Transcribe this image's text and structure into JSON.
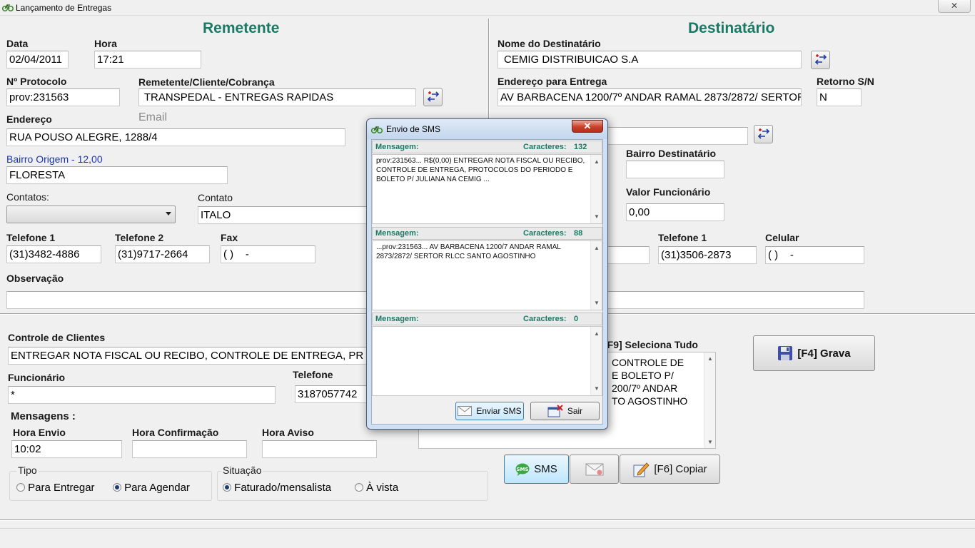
{
  "window": {
    "title": "Lançamento de Entregas",
    "close": "✕"
  },
  "remetente": {
    "heading": "Remetente",
    "data_label": "Data",
    "data_value": "02/04/2011",
    "hora_label": "Hora",
    "hora_value": "17:21",
    "protocolo_label": "Nº Protocolo",
    "protocolo_value": "prov:231563",
    "cliente_label": "Remetente/Cliente/Cobrança",
    "cliente_value": " TRANSPEDAL - ENTREGAS RAPIDAS",
    "email_label": "Email",
    "endereco_label": "Endereço",
    "endereco_value": "RUA POUSO ALEGRE, 1288/4",
    "bairro_label": "Bairro Origem - 12,00",
    "bairro_value": "FLORESTA",
    "contatos_label": "Contatos:",
    "contato_label": "Contato",
    "contato_value": "ITALO",
    "telefone1_label": "Telefone 1",
    "telefone1_value": "(31)3482-4886",
    "telefone2_label": "Telefone 2",
    "telefone2_value": "(31)9717-2664",
    "fax_label": "Fax",
    "fax_value": "( )    -",
    "obs_label": "Observação",
    "obs_value": ""
  },
  "destinatario": {
    "heading": "Destinatário",
    "nome_label": "Nome do Destinatário",
    "nome_value": "CEMIG DISTRIBUICAO S.A",
    "endereco_label": "Endereço para Entrega",
    "endereco_value": "AV BARBACENA 1200/7º ANDAR RAMAL 2873/2872/ SERTOR R",
    "retorno_label": "Retorno S/N",
    "retorno_value": "N",
    "bairro_label": "Bairro Destinatário",
    "bairro_value": "",
    "valor_label": "Valor Funcionário",
    "valor_value": "0,00",
    "telefone1_label": "Telefone 1",
    "telefone1_value": "(31)3506-2873",
    "celular_label": "Celular",
    "celular_value": "( )    -",
    "obs_value": ""
  },
  "bottom": {
    "controle_label": "Controle de Clientes",
    "controle_value": "ENTREGAR NOTA FISCAL OU RECIBO, CONTROLE DE ENTREGA, PR",
    "funcionario_label": "Funcionário",
    "funcionario_value": "*",
    "telefone_label": "Telefone",
    "telefone_value": "3187057742",
    "mensagens_label": "Mensagens :",
    "hora_envio_label": "Hora Envio",
    "hora_envio_value": "10:02",
    "hora_conf_label": "Hora Confirmação",
    "hora_conf_value": "",
    "hora_aviso_label": "Hora Aviso",
    "hora_aviso_value": "",
    "tipo_label": "Tipo",
    "tipo_opt1": "Para Entregar",
    "tipo_opt2": "Para Agendar",
    "situacao_label": "Situação",
    "sit_opt1": "Faturado/mensalista",
    "sit_opt2": "À vista",
    "seleciona_label": "[F9] Seleciona Tudo",
    "obs_lines": [
      "CONTROLE DE",
      "E BOLETO P/",
      "200/7º ANDAR",
      "TO AGOSTINHO"
    ],
    "grava_label": "[F4] Grava",
    "sms_label": "SMS",
    "copiar_label": "[F6] Copiar"
  },
  "dialog": {
    "title": "Envio de SMS",
    "msg_label": "Mensagem:",
    "chars_label": "Caracteres:",
    "messages": [
      {
        "chars": "132",
        "text": "prov:231563... R$(0,00) ENTREGAR NOTA FISCAL OU RECIBO, CONTROLE DE ENTREGA, PROTOCOLOS DO PERIODO E BOLETO P/ JULIANA  NA CEMIG ..."
      },
      {
        "chars": "88",
        "text": "...prov:231563... AV BARBACENA 1200/7 ANDAR RAMAL 2873/2872/ SERTOR RLCC SANTO AGOSTINHO"
      },
      {
        "chars": "0",
        "text": ""
      }
    ],
    "enviar_label": "Enviar SMS",
    "sair_label": "Sair"
  },
  "colors": {
    "accent_green": "#1a7a66",
    "label_blue": "#1a35b0"
  }
}
